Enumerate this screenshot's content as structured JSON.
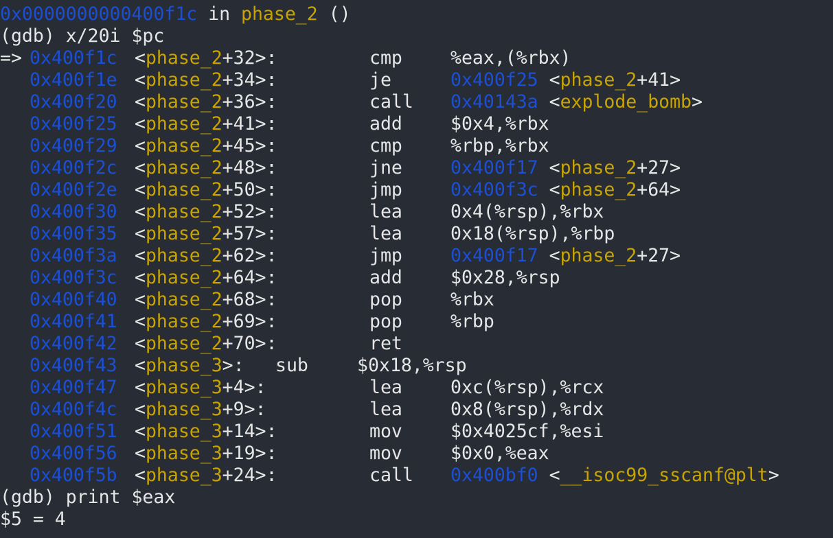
{
  "colors": {
    "background": "#282c34",
    "text": "#e6e6e6",
    "address": "#1a4fd6",
    "symbol": "#c9a400"
  },
  "terminal": {
    "frame_line": {
      "address": "0x0000000000400f1c",
      "in_text": " in ",
      "func": "phase_2",
      "args": " ()"
    },
    "cmd1": "(gdb) x/20i $pc",
    "arrow": "=>",
    "disasm": [
      {
        "addr": "0x400f1c",
        "func": "phase_2",
        "offset": "+32>:",
        "mnem": "cmp",
        "operand": "%eax,(%rbx)",
        "target": "",
        "tfunc": "",
        "tsuffix": ""
      },
      {
        "addr": "0x400f1e",
        "func": "phase_2",
        "offset": "+34>:",
        "mnem": "je",
        "operand": "",
        "target": "0x400f25",
        "tfunc": "phase_2",
        "tsuffix": "+41>"
      },
      {
        "addr": "0x400f20",
        "func": "phase_2",
        "offset": "+36>:",
        "mnem": "call",
        "operand": "",
        "target": "0x40143a",
        "tfunc": "explode_bomb",
        "tsuffix": ">"
      },
      {
        "addr": "0x400f25",
        "func": "phase_2",
        "offset": "+41>:",
        "mnem": "add",
        "operand": "$0x4,%rbx",
        "target": "",
        "tfunc": "",
        "tsuffix": ""
      },
      {
        "addr": "0x400f29",
        "func": "phase_2",
        "offset": "+45>:",
        "mnem": "cmp",
        "operand": "%rbp,%rbx",
        "target": "",
        "tfunc": "",
        "tsuffix": ""
      },
      {
        "addr": "0x400f2c",
        "func": "phase_2",
        "offset": "+48>:",
        "mnem": "jne",
        "operand": "",
        "target": "0x400f17",
        "tfunc": "phase_2",
        "tsuffix": "+27>"
      },
      {
        "addr": "0x400f2e",
        "func": "phase_2",
        "offset": "+50>:",
        "mnem": "jmp",
        "operand": "",
        "target": "0x400f3c",
        "tfunc": "phase_2",
        "tsuffix": "+64>"
      },
      {
        "addr": "0x400f30",
        "func": "phase_2",
        "offset": "+52>:",
        "mnem": "lea",
        "operand": "0x4(%rsp),%rbx",
        "target": "",
        "tfunc": "",
        "tsuffix": ""
      },
      {
        "addr": "0x400f35",
        "func": "phase_2",
        "offset": "+57>:",
        "mnem": "lea",
        "operand": "0x18(%rsp),%rbp",
        "target": "",
        "tfunc": "",
        "tsuffix": ""
      },
      {
        "addr": "0x400f3a",
        "func": "phase_2",
        "offset": "+62>:",
        "mnem": "jmp",
        "operand": "",
        "target": "0x400f17",
        "tfunc": "phase_2",
        "tsuffix": "+27>"
      },
      {
        "addr": "0x400f3c",
        "func": "phase_2",
        "offset": "+64>:",
        "mnem": "add",
        "operand": "$0x28,%rsp",
        "target": "",
        "tfunc": "",
        "tsuffix": ""
      },
      {
        "addr": "0x400f40",
        "func": "phase_2",
        "offset": "+68>:",
        "mnem": "pop",
        "operand": "%rbx",
        "target": "",
        "tfunc": "",
        "tsuffix": ""
      },
      {
        "addr": "0x400f41",
        "func": "phase_2",
        "offset": "+69>:",
        "mnem": "pop",
        "operand": "%rbp",
        "target": "",
        "tfunc": "",
        "tsuffix": ""
      },
      {
        "addr": "0x400f42",
        "func": "phase_2",
        "offset": "+70>:",
        "mnem": "ret",
        "operand": "",
        "target": "",
        "tfunc": "",
        "tsuffix": ""
      },
      {
        "addr": "0x400f43",
        "func": "phase_3",
        "offset": ">:",
        "mnem": "sub",
        "operand": "$0x18,%rsp",
        "target": "",
        "tfunc": "",
        "tsuffix": ""
      },
      {
        "addr": "0x400f47",
        "func": "phase_3",
        "offset": "+4>:",
        "mnem": "lea",
        "operand": "0xc(%rsp),%rcx",
        "target": "",
        "tfunc": "",
        "tsuffix": ""
      },
      {
        "addr": "0x400f4c",
        "func": "phase_3",
        "offset": "+9>:",
        "mnem": "lea",
        "operand": "0x8(%rsp),%rdx",
        "target": "",
        "tfunc": "",
        "tsuffix": ""
      },
      {
        "addr": "0x400f51",
        "func": "phase_3",
        "offset": "+14>:",
        "mnem": "mov",
        "operand": "$0x4025cf,%esi",
        "target": "",
        "tfunc": "",
        "tsuffix": ""
      },
      {
        "addr": "0x400f56",
        "func": "phase_3",
        "offset": "+19>:",
        "mnem": "mov",
        "operand": "$0x0,%eax",
        "target": "",
        "tfunc": "",
        "tsuffix": ""
      },
      {
        "addr": "0x400f5b",
        "func": "phase_3",
        "offset": "+24>:",
        "mnem": "call",
        "operand": "",
        "target": "0x400bf0",
        "tfunc": "__isoc99_sscanf@plt",
        "tsuffix": ">"
      }
    ],
    "cmd2": "(gdb) print $eax",
    "result": "$5 = 4"
  }
}
